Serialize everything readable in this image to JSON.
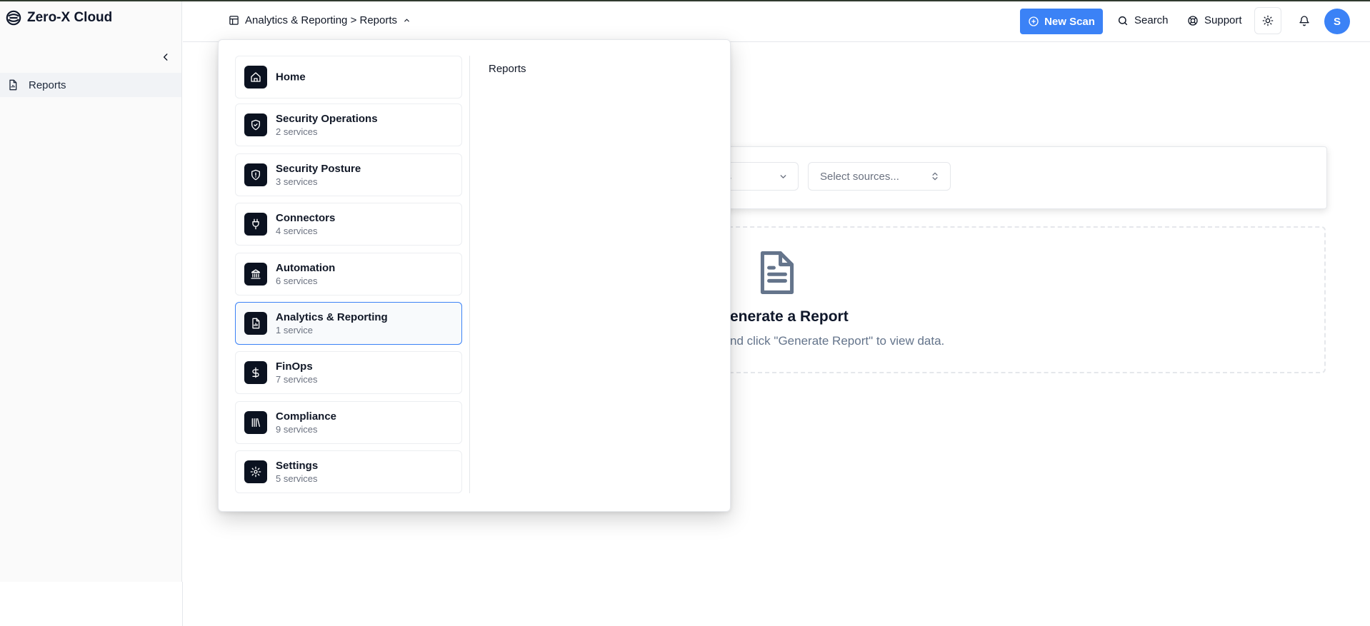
{
  "app": {
    "name": "Zero-X Cloud"
  },
  "sidebar": {
    "items": [
      {
        "label": "Reports"
      }
    ]
  },
  "header": {
    "breadcrumb": "Analytics & Reporting > Reports",
    "new_scan_label": "New Scan",
    "search_label": "Search",
    "support_label": "Support",
    "avatar_initial": "S"
  },
  "filters": {
    "first_select_visible": "es",
    "sources_placeholder": "Select sources..."
  },
  "empty_state": {
    "title_visible": "enerate a Report",
    "description_visible": "nd click \"Generate Report\" to view data."
  },
  "menu": {
    "categories": [
      {
        "name": "Home",
        "sub": "",
        "icon": "home-icon"
      },
      {
        "name": "Security Operations",
        "sub": "2 services",
        "icon": "shield-check-icon"
      },
      {
        "name": "Security Posture",
        "sub": "3 services",
        "icon": "shield-alert-icon"
      },
      {
        "name": "Connectors",
        "sub": "4 services",
        "icon": "plug-icon"
      },
      {
        "name": "Automation",
        "sub": "6 services",
        "icon": "landmark-icon"
      },
      {
        "name": "Analytics & Reporting",
        "sub": "1 service",
        "icon": "file-chart-icon"
      },
      {
        "name": "FinOps",
        "sub": "7 services",
        "icon": "dollar-icon"
      },
      {
        "name": "Compliance",
        "sub": "9 services",
        "icon": "library-icon"
      },
      {
        "name": "Settings",
        "sub": "5 services",
        "icon": "gear-icon"
      }
    ],
    "active_category": "Analytics & Reporting",
    "services": [
      "Reports"
    ]
  },
  "colors": {
    "accent": "#3b82f6",
    "icon_tile": "#0b1220"
  }
}
